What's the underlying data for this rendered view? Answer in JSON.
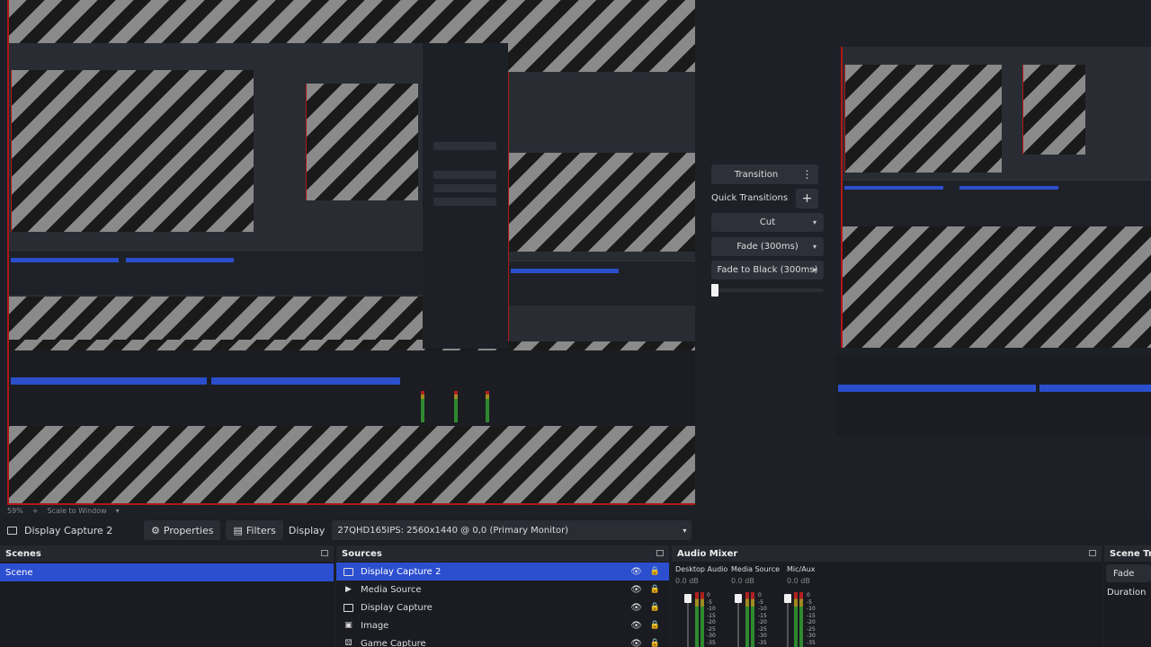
{
  "preview": {
    "zoom_level": "59%",
    "scale_mode": "Scale to Window"
  },
  "transitions": {
    "transition_label": "Transition",
    "quick_transitions_label": "Quick Transitions",
    "items": [
      "Cut",
      "Fade (300ms)",
      "Fade to Black (300ms)"
    ],
    "more_icon": "vertical-dots-icon",
    "add_icon": "plus-icon"
  },
  "context_bar": {
    "source_name": "Display Capture 2",
    "properties_label": "Properties",
    "filters_label": "Filters",
    "display_label": "Display",
    "display_value": "27QHD165IPS: 2560x1440 @ 0,0 (Primary Monitor)"
  },
  "scenes": {
    "title": "Scenes",
    "items": [
      {
        "label": "Scene"
      }
    ]
  },
  "sources": {
    "title": "Sources",
    "items": [
      {
        "label": "Display Capture 2",
        "icon": "monitor-icon"
      },
      {
        "label": "Media Source",
        "icon": "play-icon"
      },
      {
        "label": "Display Capture",
        "icon": "monitor-icon"
      },
      {
        "label": "Image",
        "icon": "image-icon"
      },
      {
        "label": "Game Capture",
        "icon": "gamepad-icon"
      }
    ]
  },
  "audio_mixer": {
    "title": "Audio Mixer",
    "channels": [
      {
        "name": "Desktop Audio",
        "db": "0.0 dB"
      },
      {
        "name": "Media Source",
        "db": "0.0 dB"
      },
      {
        "name": "Mic/Aux",
        "db": "0.0 dB"
      }
    ],
    "scale": [
      "0",
      "-5",
      "-10",
      "-15",
      "-20",
      "-25",
      "-30",
      "-35"
    ]
  },
  "scene_transitions": {
    "title": "Scene Tran",
    "fade_value": "Fade",
    "duration_label": "Duration"
  },
  "colors": {
    "accent_blue": "#2c4fd0",
    "program_border_red": "#b01818",
    "dock_bg": "#1a1c22"
  }
}
